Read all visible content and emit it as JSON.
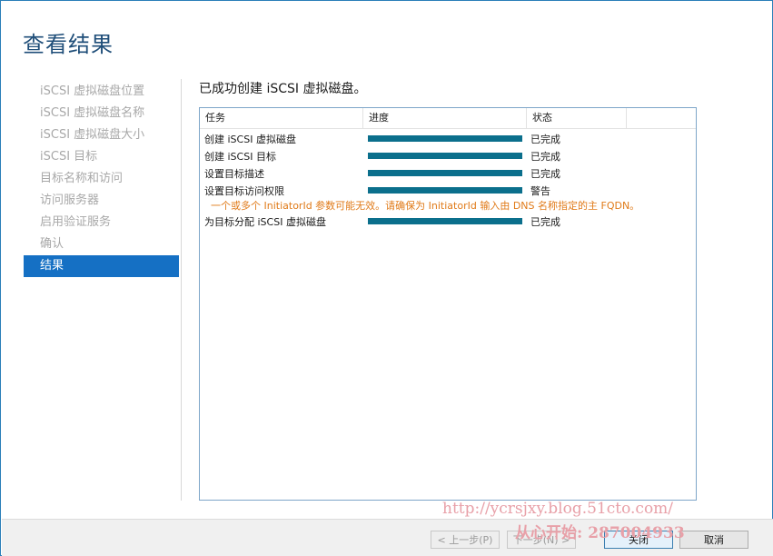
{
  "window": {
    "title": "查看结果"
  },
  "nav": {
    "items": [
      {
        "label": "iSCSI 虚拟磁盘位置"
      },
      {
        "label": "iSCSI 虚拟磁盘名称"
      },
      {
        "label": "iSCSI 虚拟磁盘大小"
      },
      {
        "label": "iSCSI 目标"
      },
      {
        "label": "目标名称和访问"
      },
      {
        "label": "访问服务器"
      },
      {
        "label": "启用验证服务"
      },
      {
        "label": "确认"
      },
      {
        "label": "结果"
      }
    ],
    "active_index": 8
  },
  "main": {
    "heading": "已成功创建 iSCSI 虚拟磁盘。",
    "table": {
      "columns": [
        "任务",
        "进度",
        "状态",
        ""
      ],
      "rows": [
        {
          "task": "创建 iSCSI 虚拟磁盘",
          "progress": 1.0,
          "status": "已完成"
        },
        {
          "task": "创建 iSCSI 目标",
          "progress": 1.0,
          "status": "已完成"
        },
        {
          "task": "设置目标描述",
          "progress": 1.0,
          "status": "已完成"
        },
        {
          "task": "设置目标访问权限",
          "progress": 1.0,
          "status": "警告"
        },
        {
          "task": "为目标分配 iSCSI 虚拟磁盘",
          "progress": 1.0,
          "status": "已完成"
        }
      ],
      "warning": "一个或多个 InitiatorId 参数可能无效。请确保为 InitiatorId 输入由 DNS 名称指定的主 FQDN。"
    }
  },
  "footer": {
    "prev_label": "< 上一步(P)",
    "next_label": "下一步(N) >",
    "close_label": "关闭",
    "cancel_label": "取消"
  },
  "watermark": {
    "line1": "http://ycrsjxy.blog.51cto.com/",
    "line2": "从心开始: 287004933"
  },
  "colors": {
    "accent": "#1570c4",
    "progress": "#0b6f8c",
    "warning": "#e07b1a"
  }
}
